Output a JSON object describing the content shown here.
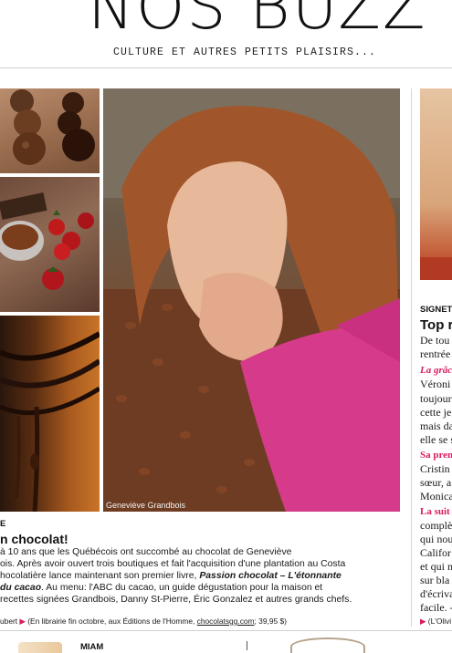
{
  "header": {
    "title": "NOS BUZZ",
    "subtitle": "CULTURE ET AUTRES PETITS PLAISIRS..."
  },
  "photo_credit": "Geneviève Grandbois",
  "article": {
    "kicker": "E",
    "headline": "n chocolat!",
    "lines": [
      "à 10 ans que les Québécois ont succombé au chocolat de Geneviève",
      "ois. Après avoir ouvert trois boutiques et fait l'acquisition d'une plantation au Costa",
      "hocolatière lance maintenant son premier livre,",
      "du cacao",
      ". Au menu: l'ABC du cacao, un guide dégustation pour la maison et",
      "recettes signées Grandbois, Danny St-Pierre, Éric Gonzalez et autres grands chefs."
    ],
    "book_title": "Passion chocolat – L'étonnante",
    "credit_name": "ubert",
    "credit_text": "(En librairie fin octobre, aux Éditions de l'Homme,",
    "credit_link": "chocolatsgg.com",
    "credit_price": "; 39,95 $)"
  },
  "signet": {
    "label": "SIGNET",
    "title": "Top r",
    "lines": [
      {
        "text": "De tou",
        "style": "normal"
      },
      {
        "text": "rentrée",
        "style": "normal"
      },
      {
        "text": "La grâc",
        "style": "pink-it"
      },
      {
        "text": "Véroni",
        "style": "normal"
      },
      {
        "text": "toujour",
        "style": "normal"
      },
      {
        "text": "cette je",
        "style": "normal"
      },
      {
        "text": "mais da",
        "style": "normal"
      },
      {
        "text": "elle se s",
        "style": "normal"
      },
      {
        "text": "Sa pren",
        "style": "pink"
      },
      {
        "text": "Cristin",
        "style": "normal"
      },
      {
        "text": "sœur, a",
        "style": "normal"
      },
      {
        "text": "Monica",
        "style": "normal"
      },
      {
        "text": "La suit",
        "style": "pink"
      },
      {
        "text": "complè",
        "style": "normal"
      },
      {
        "text": "qui nou",
        "style": "normal"
      },
      {
        "text": "Califor",
        "style": "normal"
      },
      {
        "text": "et qui n",
        "style": "normal"
      },
      {
        "text": "sur bla",
        "style": "normal"
      },
      {
        "text": "d'écriva",
        "style": "normal"
      },
      {
        "text": "facile. -",
        "style": "normal"
      }
    ],
    "credit": "(L'Olivi"
  },
  "footer": {
    "label": "MIAM"
  },
  "colors": {
    "accent_pink": "#d81b60",
    "rule_gray": "#d0d0d0"
  }
}
